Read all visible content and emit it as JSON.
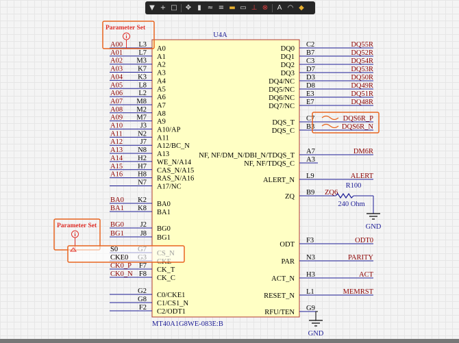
{
  "toolbar": {
    "icons": [
      "filter-icon",
      "add-icon",
      "rect-select-icon",
      "move-icon",
      "align-icon",
      "wire-icon",
      "bus-icon",
      "net-label-icon",
      "port-icon",
      "power-port-icon",
      "no-erc-icon",
      "text-icon",
      "arc-icon",
      "junction-icon"
    ]
  },
  "component": {
    "designator": "U4A",
    "part_name": "MT40A1G8WE-083E:B",
    "left_pins": [
      {
        "num": "L3",
        "name": "A0",
        "net": "A00"
      },
      {
        "num": "L7",
        "name": "A1",
        "net": "A01"
      },
      {
        "num": "M3",
        "name": "A2",
        "net": "A02"
      },
      {
        "num": "K7",
        "name": "A3",
        "net": "A03"
      },
      {
        "num": "K3",
        "name": "A4",
        "net": "A04"
      },
      {
        "num": "L8",
        "name": "A5",
        "net": "A05"
      },
      {
        "num": "L2",
        "name": "A6",
        "net": "A06"
      },
      {
        "num": "M8",
        "name": "A7",
        "net": "A07"
      },
      {
        "num": "M2",
        "name": "A8",
        "net": "A08"
      },
      {
        "num": "M7",
        "name": "A9",
        "net": "A09"
      },
      {
        "num": "J3",
        "name": "A10/AP",
        "net": "A10"
      },
      {
        "num": "N2",
        "name": "A11",
        "net": "A11"
      },
      {
        "num": "J7",
        "name": "A12/BC_N",
        "net": "A12"
      },
      {
        "num": "N8",
        "name": "A13",
        "net": "A13"
      },
      {
        "num": "H2",
        "name": "WE_N/A14",
        "net": "A14"
      },
      {
        "num": "H7",
        "name": "CAS_N/A15",
        "net": "A15"
      },
      {
        "num": "H8",
        "name": "RAS_N/A16",
        "net": "A16"
      },
      {
        "num": "N7",
        "name": "A17/NC",
        "net": ""
      },
      {
        "num": "K2",
        "name": "BA0",
        "net": "BA0"
      },
      {
        "num": "K8",
        "name": "BA1",
        "net": "BA1"
      },
      {
        "num": "J2",
        "name": "BG0",
        "net": "BG0"
      },
      {
        "num": "J8",
        "name": "BG1",
        "net": "BG1"
      },
      {
        "num": "G7",
        "name": "CS_N",
        "net": "S0"
      },
      {
        "num": "G3",
        "name": "CKE",
        "net": "CKE0"
      },
      {
        "num": "F7",
        "name": "CK_T",
        "net": "CK0_P"
      },
      {
        "num": "F8",
        "name": "CK_C",
        "net": "CK0_N"
      },
      {
        "num": "G2",
        "name": "C0/CKE1",
        "net": ""
      },
      {
        "num": "G8",
        "name": "C1/CS1_N",
        "net": ""
      },
      {
        "num": "F2",
        "name": "C2/ODT1",
        "net": ""
      }
    ],
    "right_pins": [
      {
        "num": "C2",
        "name": "DQ0",
        "net": "DQ55R"
      },
      {
        "num": "B7",
        "name": "DQ1",
        "net": "DQ52R"
      },
      {
        "num": "C3",
        "name": "DQ2",
        "net": "DQ54R"
      },
      {
        "num": "D7",
        "name": "DQ3",
        "net": "DQ53R"
      },
      {
        "num": "D3",
        "name": "DQ4/NC",
        "net": "DQ50R"
      },
      {
        "num": "D8",
        "name": "DQ5/NC",
        "net": "DQ49R"
      },
      {
        "num": "E3",
        "name": "DQ6/NC",
        "net": "DQ51R"
      },
      {
        "num": "E7",
        "name": "DQ7/NC",
        "net": "DQ48R"
      },
      {
        "num": "C7",
        "name": "DQS_T",
        "net": "DQS6R_P"
      },
      {
        "num": "B3",
        "name": "DQS_C",
        "net": "DQS6R_N"
      },
      {
        "num": "A7",
        "name": "NF, NF/DM_N/DBI_N/TDQS_T",
        "net": "DM6R"
      },
      {
        "num": "A3",
        "name": "NF, NF/TDQS_C",
        "net": ""
      },
      {
        "num": "L9",
        "name": "ALERT_N",
        "net": "ALERT"
      },
      {
        "num": "B9",
        "name": "ZQ",
        "net": "ZQ6"
      },
      {
        "num": "F3",
        "name": "ODT",
        "net": "ODT0"
      },
      {
        "num": "N3",
        "name": "PAR",
        "net": "PARITY"
      },
      {
        "num": "H3",
        "name": "ACT_N",
        "net": "ACT"
      },
      {
        "num": "L1",
        "name": "RESET_N",
        "net": "MEMRST"
      },
      {
        "num": "G9",
        "name": "RFU/TEN",
        "net": ""
      }
    ]
  },
  "resistor": {
    "designator": "R100",
    "value": "240 Ohm"
  },
  "gnd_labels": [
    "GND",
    "GND"
  ],
  "param_sets": [
    {
      "label": "Parameter Set"
    },
    {
      "label": "Parameter Set"
    }
  ],
  "colors": {
    "body_fill": "#ffffc4",
    "body_stroke": "#b03a2e",
    "pin_text": "#000000",
    "pin_num": "#000000",
    "net_label": "#8b0000",
    "wire": "#1d1d96",
    "designator": "#1d1d96",
    "param_orange": "#e8641e",
    "gnd_wire": "#000000"
  }
}
